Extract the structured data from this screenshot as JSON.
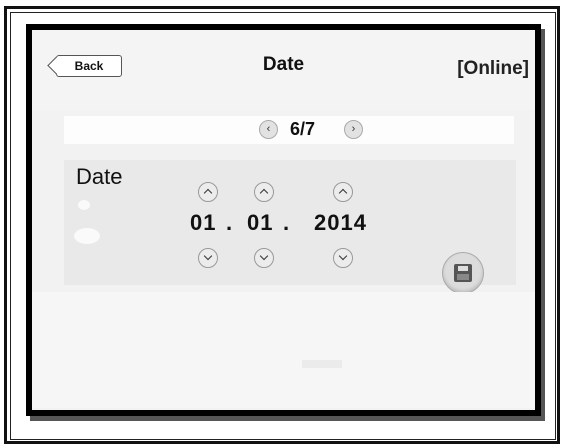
{
  "header": {
    "back_label": "Back",
    "title": "Date",
    "status": "[Online]"
  },
  "pager": {
    "label": "6/7",
    "prev_icon": "chevron-left-icon",
    "next_icon": "chevron-right-icon"
  },
  "date_section": {
    "label": "Date",
    "day": "01",
    "month": "01",
    "year": "2014",
    "separator": ".",
    "up_icon": "chevron-up-icon",
    "down_icon": "chevron-down-icon",
    "save_icon": "floppy-disk-icon"
  }
}
